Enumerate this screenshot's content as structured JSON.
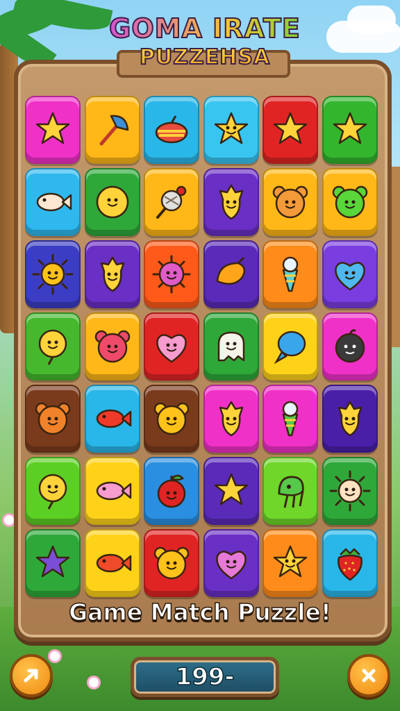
{
  "title": {
    "line1": "GOMA IRATE",
    "line2": "PUZZEHSA"
  },
  "caption": "Game Match Puzzle!",
  "score": "199-",
  "buttons": {
    "left_icon": "arrow-icon",
    "right_icon": "close-icon"
  },
  "board": {
    "rows": [
      [
        {
          "color": "#f031c8",
          "icon": "star",
          "fill": "#ffd33a"
        },
        {
          "color": "#ffb818",
          "icon": "arrow",
          "fill": "#3b8fd6"
        },
        {
          "color": "#29b6e8",
          "icon": "top",
          "fill": "#e74c3c"
        },
        {
          "color": "#38c5f0",
          "icon": "star-face",
          "fill": "#ffd33a"
        },
        {
          "color": "#e02424",
          "icon": "star",
          "fill": "#ffd33a"
        },
        {
          "color": "#33b52e",
          "icon": "star",
          "fill": "#ffd33a"
        }
      ],
      [
        {
          "color": "#2fb8ee",
          "icon": "fish",
          "fill": "#fbe7d2"
        },
        {
          "color": "#2fa83a",
          "icon": "smiley",
          "fill": "#ffd33a"
        },
        {
          "color": "#ffb818",
          "icon": "lollipop",
          "fill": "#e0e0e0"
        },
        {
          "color": "#6a2fc4",
          "icon": "drop-face",
          "fill": "#ffd33a"
        },
        {
          "color": "#ffb818",
          "icon": "bear",
          "fill": "#f39a3a"
        },
        {
          "color": "#ffb818",
          "icon": "bear",
          "fill": "#58d63a"
        }
      ],
      [
        {
          "color": "#3b3ec4",
          "icon": "sun",
          "fill": "#ffc21a"
        },
        {
          "color": "#6a2fc4",
          "icon": "drop-face",
          "fill": "#ffd33a"
        },
        {
          "color": "#ff5a1a",
          "icon": "virus",
          "fill": "#e05cc9"
        },
        {
          "color": "#5a2bb8",
          "icon": "mango",
          "fill": "#ffa51a"
        },
        {
          "color": "#ff8c1a",
          "icon": "cone",
          "fill": "#5ed0d6"
        },
        {
          "color": "#7a3de0",
          "icon": "heart-face",
          "fill": "#4fb8ee"
        }
      ],
      [
        {
          "color": "#46b82e",
          "icon": "balloon-face",
          "fill": "#ffd33a"
        },
        {
          "color": "#ffb818",
          "icon": "bear",
          "fill": "#ef4a6a"
        },
        {
          "color": "#e02424",
          "icon": "heart-face",
          "fill": "#f79ccf"
        },
        {
          "color": "#2fa83a",
          "icon": "ghost",
          "fill": "#f4f4ea"
        },
        {
          "color": "#ffd21a",
          "icon": "balloon",
          "fill": "#3aa6ea"
        },
        {
          "color": "#f031c8",
          "icon": "blob",
          "fill": "#3a3a3a"
        }
      ],
      [
        {
          "color": "#7a3b1c",
          "icon": "bear",
          "fill": "#f0822a"
        },
        {
          "color": "#29b6e8",
          "icon": "fish",
          "fill": "#ef3a2a"
        },
        {
          "color": "#7a3b1c",
          "icon": "bear",
          "fill": "#ffc21a"
        },
        {
          "color": "#f031c8",
          "icon": "drop-face",
          "fill": "#ffd33a"
        },
        {
          "color": "#f031c8",
          "icon": "cone",
          "fill": "#56c84a"
        },
        {
          "color": "#4a1fa8",
          "icon": "drop-face",
          "fill": "#ffd33a"
        }
      ],
      [
        {
          "color": "#5ccf24",
          "icon": "balloon-face",
          "fill": "#ffd33a"
        },
        {
          "color": "#ffd21a",
          "icon": "fish",
          "fill": "#f79ccf"
        },
        {
          "color": "#2a8fe0",
          "icon": "apple",
          "fill": "#e02424"
        },
        {
          "color": "#5a2bb8",
          "icon": "star",
          "fill": "#ffd33a"
        },
        {
          "color": "#6fd62a",
          "icon": "octopus",
          "fill": "#56c84a"
        },
        {
          "color": "#2fa83a",
          "icon": "sun",
          "fill": "#ffe2c2"
        }
      ],
      [
        {
          "color": "#2fa83a",
          "icon": "star",
          "fill": "#7a4ed6"
        },
        {
          "color": "#ffd21a",
          "icon": "fish",
          "fill": "#ef4a2a"
        },
        {
          "color": "#e02424",
          "icon": "bear",
          "fill": "#ffc21a"
        },
        {
          "color": "#6a2fc4",
          "icon": "heart-face",
          "fill": "#e67ad6"
        },
        {
          "color": "#ff8c1a",
          "icon": "star-face",
          "fill": "#ffd33a"
        },
        {
          "color": "#29b6e8",
          "icon": "strawberry",
          "fill": "#e02424"
        }
      ]
    ]
  }
}
